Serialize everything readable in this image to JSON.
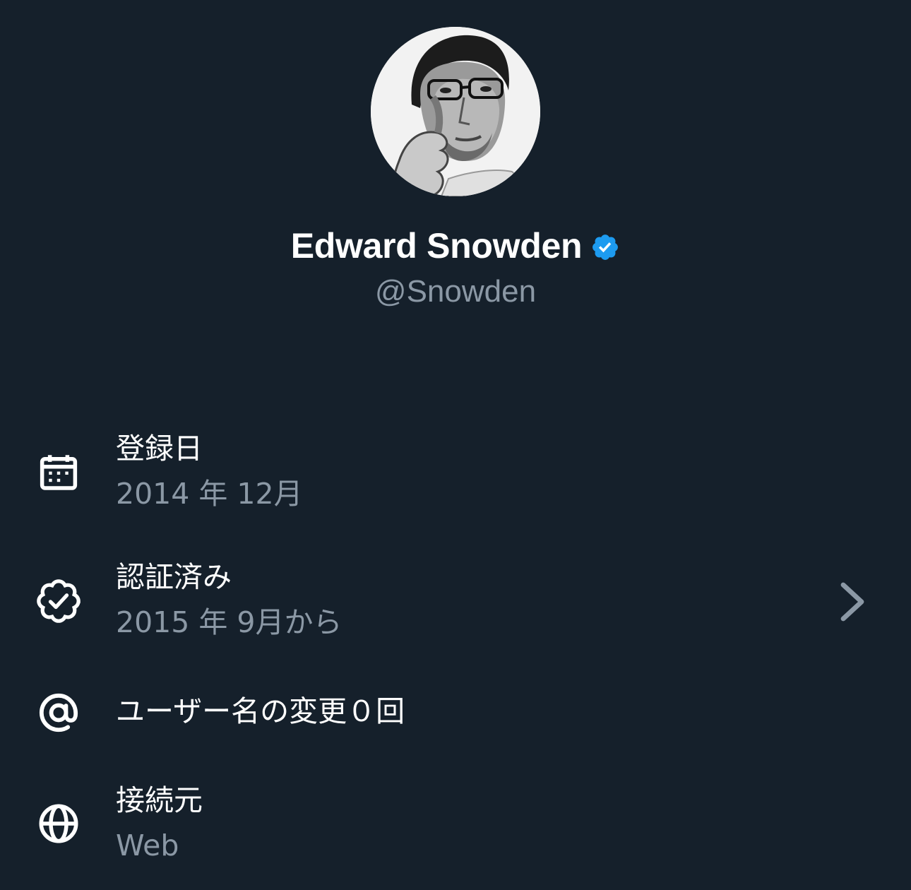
{
  "profile": {
    "display_name": "Edward Snowden",
    "handle": "@Snowden",
    "verified": true,
    "badge_color": "#1d9bf0"
  },
  "about": {
    "joined": {
      "label": "登録日",
      "value": "2014 年 12月",
      "icon": "calendar-icon"
    },
    "verified": {
      "label": "認証済み",
      "value": "2015 年 9月から",
      "icon": "verified-outline-icon"
    },
    "username_changes": {
      "label": "ユーザー名の変更０回",
      "icon": "at-sign-icon"
    },
    "connected_via": {
      "label": "接続元",
      "value": "Web",
      "icon": "globe-icon"
    }
  },
  "colors": {
    "background": "#15202b",
    "primary_text": "#ffffff",
    "secondary_text": "#8b98a5"
  }
}
